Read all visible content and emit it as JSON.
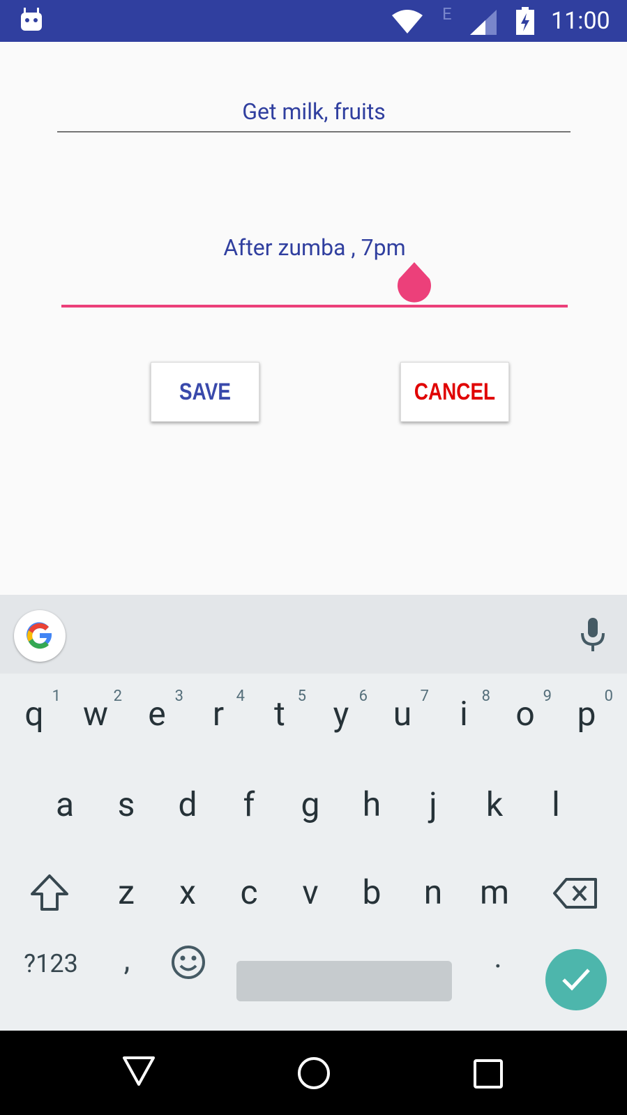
{
  "status_bar": {
    "time": "11:00",
    "network_type": "E",
    "icons": [
      "android-debug-icon",
      "wifi-icon",
      "signal-icon",
      "battery-charging-icon"
    ]
  },
  "form": {
    "note_field": {
      "value": "Get milk, fruits"
    },
    "time_field": {
      "value": "After zumba , 7pm"
    },
    "save_label": "SAVE",
    "cancel_label": "CANCEL"
  },
  "keyboard": {
    "suggestion_bar": {
      "left_icon": "google-g-icon",
      "right_icon": "mic-icon"
    },
    "row1": [
      {
        "key": "q",
        "hint": "1"
      },
      {
        "key": "w",
        "hint": "2"
      },
      {
        "key": "e",
        "hint": "3"
      },
      {
        "key": "r",
        "hint": "4"
      },
      {
        "key": "t",
        "hint": "5"
      },
      {
        "key": "y",
        "hint": "6"
      },
      {
        "key": "u",
        "hint": "7"
      },
      {
        "key": "i",
        "hint": "8"
      },
      {
        "key": "o",
        "hint": "9"
      },
      {
        "key": "p",
        "hint": "0"
      }
    ],
    "row2": [
      "a",
      "s",
      "d",
      "f",
      "g",
      "h",
      "j",
      "k",
      "l"
    ],
    "row3": [
      "z",
      "x",
      "c",
      "v",
      "b",
      "n",
      "m"
    ],
    "symbols_label": "?123",
    "comma": ",",
    "period": ".",
    "enter_icon": "check-icon"
  },
  "nav_bar": {
    "icons": [
      "back-icon",
      "home-icon",
      "recents-icon"
    ]
  },
  "colors": {
    "primary_dark": "#303f9f",
    "text_primary": "#303f9f",
    "accent": "#ec407a",
    "cancel_red": "#e00000",
    "enter_teal": "#4db6ac"
  }
}
